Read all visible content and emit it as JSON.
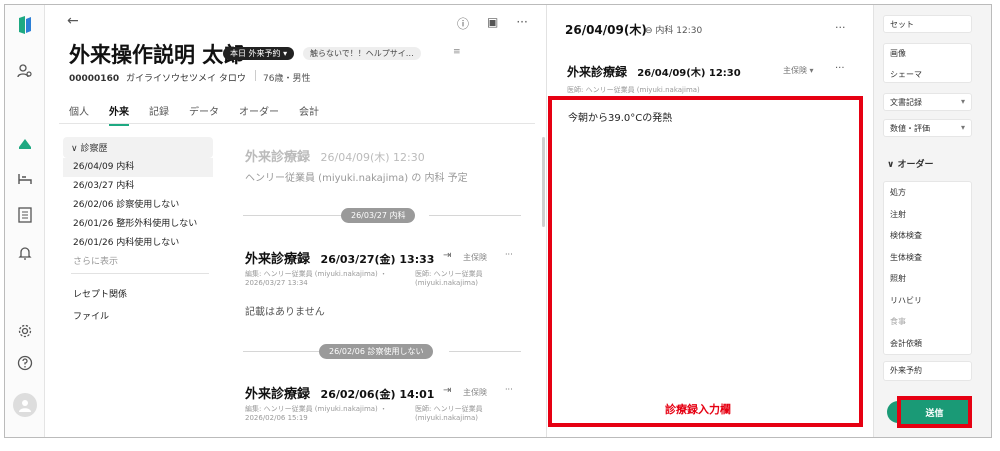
{
  "patient": {
    "name": "外来操作説明 太郎",
    "badge_reservation": "本日 外来予約 ▾",
    "badge_note": "触らないで！！ヘルプサイ…",
    "id": "00000160",
    "kana": "ガイライソウセツメイ タロウ",
    "age_sex": "76歳・男性"
  },
  "header": {
    "back": "←",
    "icons": [
      "ⓘ",
      "▣",
      "···"
    ]
  },
  "tabs": [
    "個人",
    "外来",
    "記録",
    "データ",
    "オーダー",
    "会計"
  ],
  "history": {
    "header": "∨ 診察歴",
    "items": [
      "26/04/09 内科",
      "26/03/27 内科",
      "26/02/06 診察使用しない",
      "26/01/26 整形外科使用しない",
      "26/01/26 内科使用しない"
    ],
    "more": "さらに表示",
    "links": [
      "レセプト関係",
      "ファイル"
    ]
  },
  "timeline": {
    "planned": {
      "title": "外来診療録",
      "datetime": "26/04/09(木) 12:30",
      "sub": "ヘンリー従業員 (miyuki.nakajima) の 内科 予定"
    },
    "pill1": "26/03/27  内科",
    "record1": {
      "title": "外来診療録",
      "datetime": "26/03/27(金) 13:33",
      "insurance": "主保険",
      "edit_meta": "編集: ヘンリー従業員 (miyuki.nakajima) ・",
      "edit_date": "2026/03/27 13:34",
      "doctor_meta": "医師: ヘンリー従業員",
      "doctor_id": "(miyuki.nakajima)",
      "body": "記載はありません"
    },
    "pill2": "26/02/06  診察使用しない",
    "record2": {
      "title": "外来診療録",
      "datetime": "26/02/06(金) 14:01",
      "insurance": "主保険",
      "edit_meta": "編集: ヘンリー従業員 (miyuki.nakajima) ・",
      "edit_date": "2026/02/06 15:19",
      "doctor_meta": "医師: ヘンリー従業員",
      "doctor_id": "(miyuki.nakajima)"
    }
  },
  "editor": {
    "date": "26/04/09(木)",
    "link": "内科 12:30",
    "title": "外来診療録",
    "datetime": "26/04/09(木) 12:30",
    "insurance": "主保険 ▾",
    "doctor": "医師: ヘンリー従業員 (miyuki.nakajima)",
    "text": "今朝から39.0°Cの発熱",
    "annotation": "診療録入力欄"
  },
  "right_panel": {
    "top_buttons": [
      "セット",
      "画像",
      "シェーマ",
      "文書記録",
      "数値・評価"
    ],
    "order_header": "∨ オーダー",
    "orders": [
      "処方",
      "注射",
      "検体検査",
      "生体検査",
      "照射",
      "リハビリ",
      "食事",
      "会計依頼"
    ],
    "reserve": "外来予約",
    "send": "送信"
  },
  "colors": {
    "accent": "#1a9a76",
    "annotation": "#e60012"
  }
}
